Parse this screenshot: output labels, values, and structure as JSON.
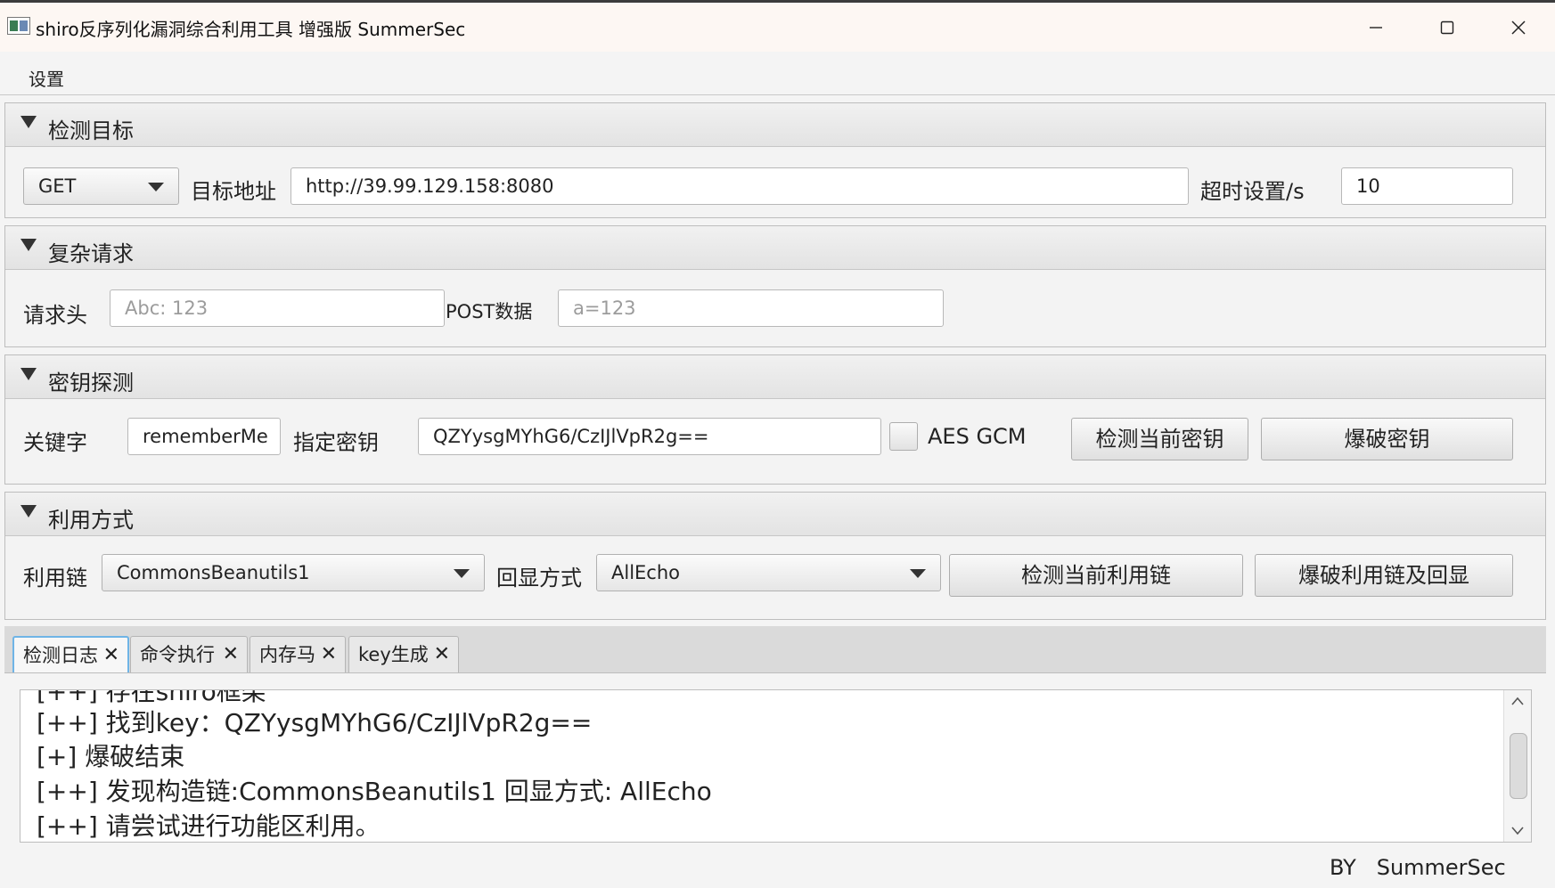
{
  "window": {
    "title": "shiro反序列化漏洞综合利用工具 增强版 SummerSec",
    "minimize_icon": "minimize-icon",
    "maximize_icon": "maximize-icon",
    "close_icon": "close-icon"
  },
  "menu": {
    "settings": "设置"
  },
  "target": {
    "header": "检测目标",
    "method": "GET",
    "address_label": "目标地址",
    "address_value": "http://39.99.129.158:8080",
    "timeout_label": "超时设置/s",
    "timeout_value": "10"
  },
  "complex": {
    "header": "复杂请求",
    "headers_label": "请求头",
    "headers_placeholder": "Abc: 123",
    "post_label": "POST数据",
    "post_placeholder": "a=123"
  },
  "key": {
    "header": "密钥探测",
    "keyword_label": "关键字",
    "keyword_value": "rememberMe",
    "specified_label": "指定密钥",
    "specified_value": "QZYysgMYhG6/CzIJlVpR2g==",
    "aes_gcm_label": "AES GCM",
    "aes_gcm_checked": false,
    "check_button": "检测当前密钥",
    "brute_button": "爆破密钥"
  },
  "exploit": {
    "header": "利用方式",
    "chain_label": "利用链",
    "chain_value": "CommonsBeanutils1",
    "echo_label": "回显方式",
    "echo_value": "AllEcho",
    "check_button": "检测当前利用链",
    "brute_button": "爆破利用链及回显"
  },
  "tabs": [
    {
      "label": "检测日志",
      "active": true
    },
    {
      "label": "命令执行",
      "active": false
    },
    {
      "label": "内存马",
      "active": false
    },
    {
      "label": "key生成",
      "active": false
    }
  ],
  "log": {
    "partial_line": "[++] 存在shiro框架",
    "lines": [
      "[++] 找到key：QZYysgMYhG6/CzIJlVpR2g==",
      "[+] 爆破结束",
      "[++] 发现构造链:CommonsBeanutils1  回显方式: AllEcho",
      "[++] 请尝试进行功能区利用。"
    ]
  },
  "footer": {
    "by": "BY",
    "author": "SummerSec"
  },
  "colors": {
    "active_tab_border": "#6fb4e6",
    "window_bg": "#f4f4f4",
    "titlebar_bg": "#fdf7f3"
  }
}
